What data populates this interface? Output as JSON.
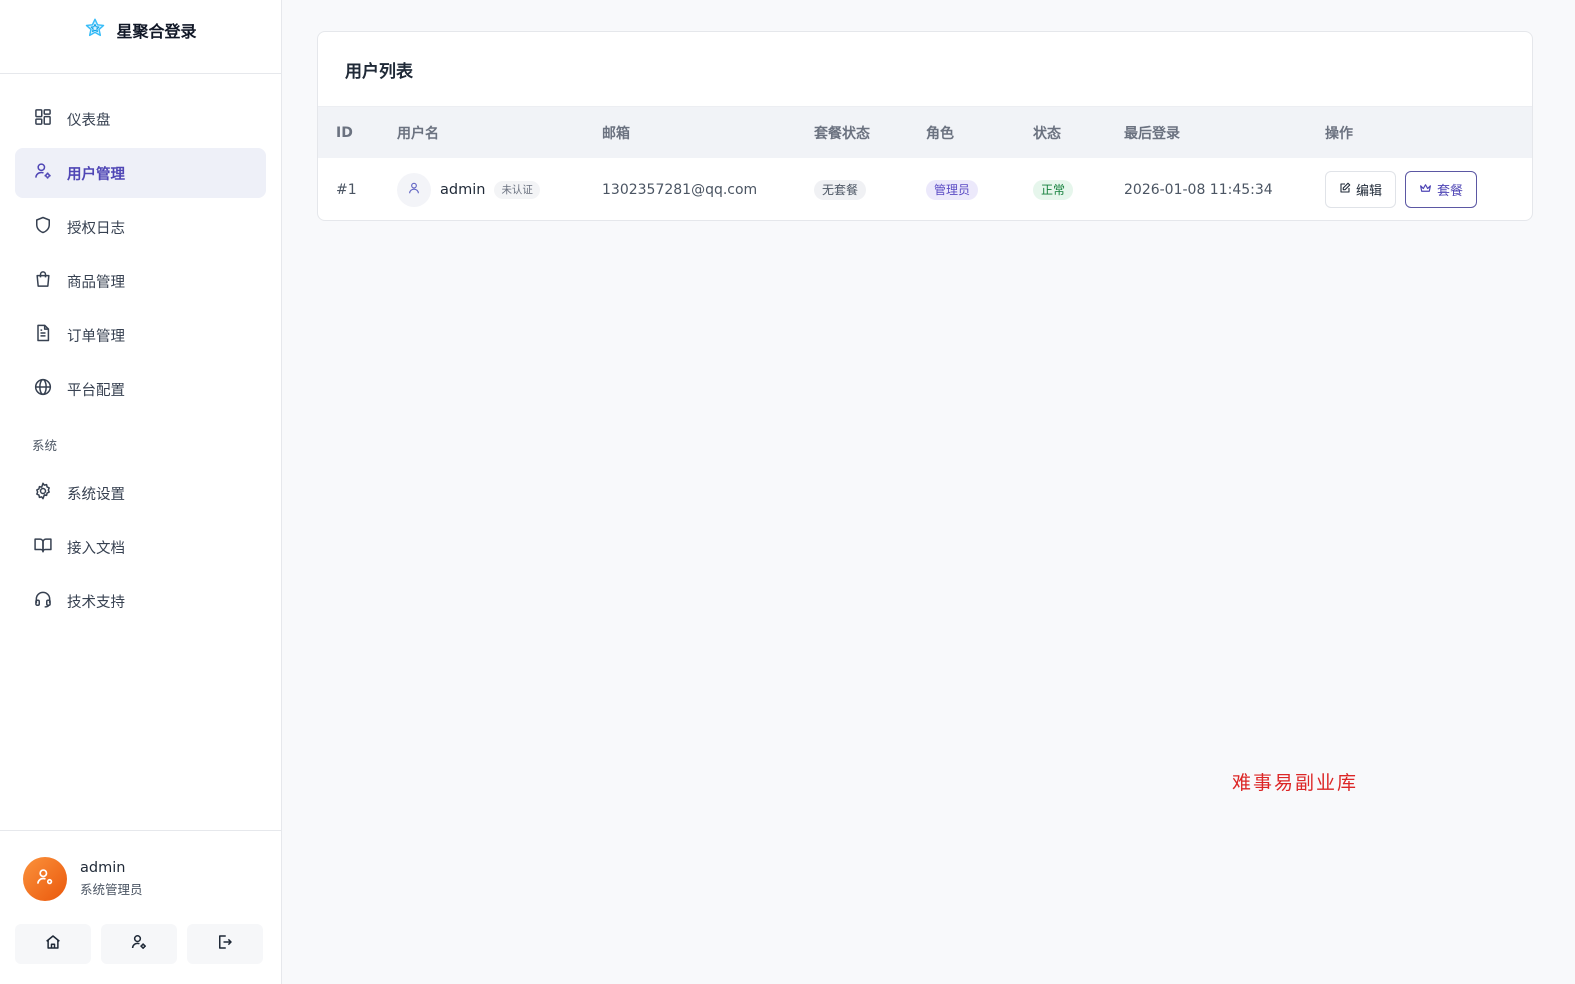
{
  "brand": {
    "name": "星聚合登录",
    "icon": "star-icon"
  },
  "nav": {
    "items": [
      {
        "label": "仪表盘",
        "icon": "dashboard-icon"
      },
      {
        "label": "用户管理",
        "icon": "user-settings-icon",
        "active": true
      },
      {
        "label": "授权日志",
        "icon": "shield-icon"
      },
      {
        "label": "商品管理",
        "icon": "shopping-bag-icon"
      },
      {
        "label": "订单管理",
        "icon": "document-icon"
      },
      {
        "label": "平台配置",
        "icon": "globe-icon"
      }
    ],
    "section_label": "系统",
    "system_items": [
      {
        "label": "系统设置",
        "icon": "gear-icon"
      },
      {
        "label": "接入文档",
        "icon": "book-icon"
      },
      {
        "label": "技术支持",
        "icon": "headset-icon"
      }
    ]
  },
  "current_user": {
    "name": "admin",
    "role": "系统管理员"
  },
  "footer_actions": [
    "home-icon",
    "user-settings-icon",
    "logout-icon"
  ],
  "main": {
    "title": "用户列表",
    "columns": [
      "ID",
      "用户名",
      "邮箱",
      "套餐状态",
      "角色",
      "状态",
      "最后登录",
      "操作"
    ],
    "rows": [
      {
        "id": "#1",
        "username": "admin",
        "verify": "未认证",
        "email": "1302357281@qq.com",
        "plan_status": "无套餐",
        "role": "管理员",
        "status": "正常",
        "last_login": "2026-01-08 11:45:34",
        "edit_label": "编辑",
        "plan_label": "套餐"
      }
    ]
  },
  "watermark": "难事易副业库",
  "colors": {
    "accent": "#4f46b5",
    "active_bg": "#eef0f8",
    "status_ok": "#15803d",
    "avatar_orange": "#f97316",
    "watermark": "#dc2626"
  }
}
